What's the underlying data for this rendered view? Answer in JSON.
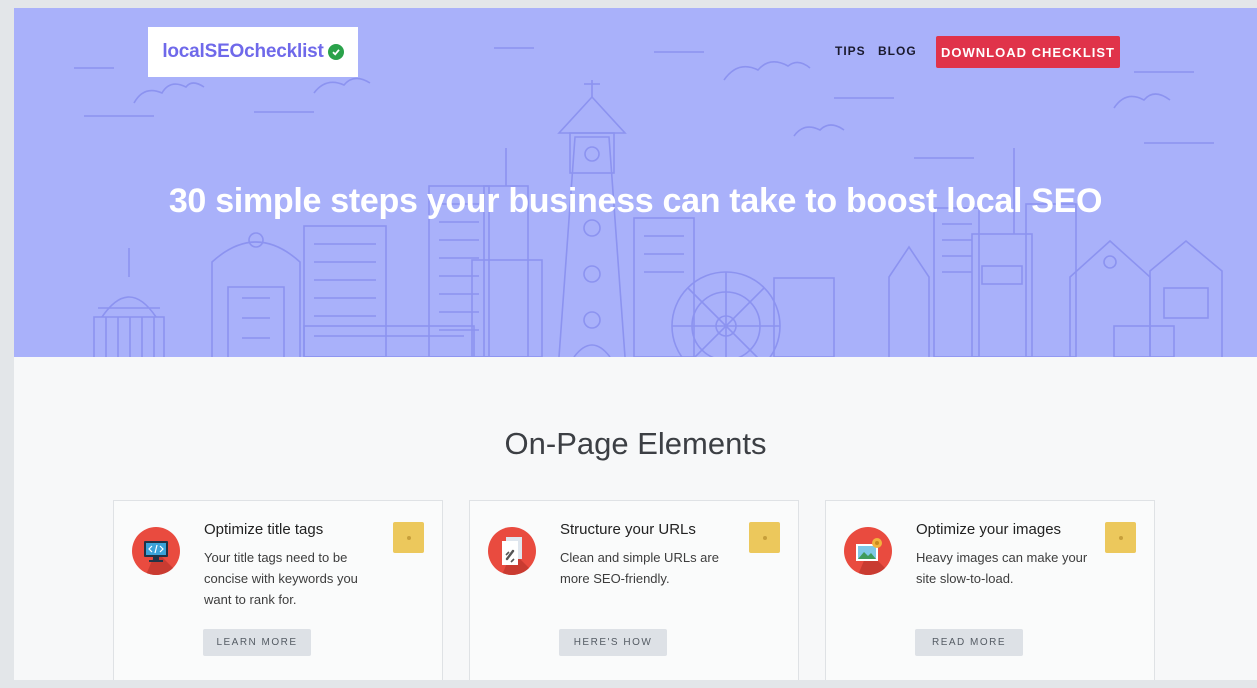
{
  "logo": {
    "text": "localSEOchecklist",
    "check_icon": "check-circle-icon",
    "check_color": "#2aa24a"
  },
  "nav": {
    "tips": "TIPS",
    "blog": "BLOG",
    "download": "DOWNLOAD CHECKLIST"
  },
  "hero": {
    "title": "30 simple steps your business can take to boost local SEO",
    "background": "#a9b1fa"
  },
  "section": {
    "title": "On-Page Elements"
  },
  "cards": [
    {
      "title": "Optimize title tags",
      "description": "Your title tags need to be concise with keywords you want to rank for.",
      "button": "LEARN MORE",
      "icon": "code-monitor-icon"
    },
    {
      "title": "Structure your URLs",
      "description": "Clean and simple URLs are more SEO-friendly.",
      "button": "HERE'S HOW",
      "icon": "link-document-icon"
    },
    {
      "title": "Optimize your images",
      "description": "Heavy images can make your site slow-to-load.",
      "button": "READ MORE",
      "icon": "image-gear-icon"
    }
  ],
  "colors": {
    "accent_red": "#e0334a",
    "badge_yellow": "#ecc85c",
    "icon_red": "#e94b3f"
  }
}
